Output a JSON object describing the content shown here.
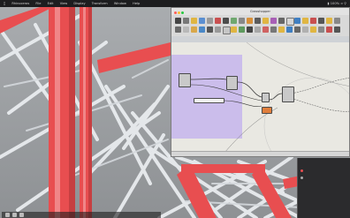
{
  "menubar": {
    "app": "Rhinoceros",
    "items": [
      "File",
      "Edit",
      "View",
      "Display",
      "Transform",
      "Window",
      "Help"
    ],
    "status": "100%"
  },
  "grasshopper": {
    "title": "Grasshopper",
    "subbar_text": "",
    "slider_value": "",
    "statusbar": ""
  },
  "panel": {
    "title": "",
    "rows": [
      "",
      "",
      ""
    ]
  },
  "colors": {
    "tube_red": "#e84e50",
    "tube_white": "#e9ecef",
    "group_purple": "#c8b8ec",
    "wire_dark": "#3a3a3a"
  }
}
